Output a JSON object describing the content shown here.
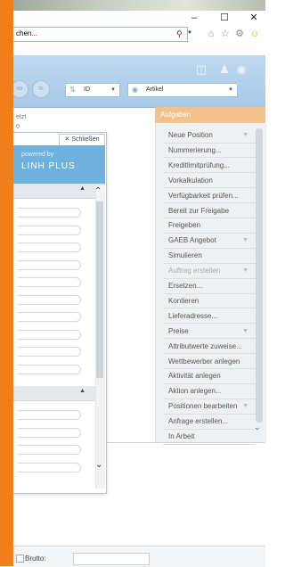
{
  "browser": {
    "address_text": "chen...",
    "window_controls": [
      "–",
      "☐",
      "✕"
    ],
    "toolbar_icons": [
      "home-icon",
      "star-icon",
      "gear-icon",
      "smiley-icon"
    ]
  },
  "toolbar": {
    "sort_select_value": "ID",
    "artikel_select_value": "Artikel"
  },
  "content": {
    "status_line1": "etzt",
    "status_line2": "0"
  },
  "aufgaben": {
    "header": "Aufgaben",
    "items": [
      {
        "label": "Neue Position",
        "has_arrow": true,
        "disabled": false
      },
      {
        "label": "Nummerierung...",
        "has_arrow": false,
        "disabled": false
      },
      {
        "label": "Kreditlimitprüfung...",
        "has_arrow": false,
        "disabled": false
      },
      {
        "label": "Vorkalkulation",
        "has_arrow": false,
        "disabled": false
      },
      {
        "label": "Verfügbarkeit prüfen...",
        "has_arrow": false,
        "disabled": false
      },
      {
        "label": "Bereit zur Freigabe",
        "has_arrow": false,
        "disabled": false
      },
      {
        "label": "Freigeben",
        "has_arrow": false,
        "disabled": false
      },
      {
        "label": "GAEB Angebot",
        "has_arrow": true,
        "disabled": false
      },
      {
        "label": "Simulieren",
        "has_arrow": false,
        "disabled": false
      },
      {
        "label": "Auftrag erstellen",
        "has_arrow": true,
        "disabled": true
      },
      {
        "label": "Ersetzen...",
        "has_arrow": false,
        "disabled": false
      },
      {
        "label": "Kontieren",
        "has_arrow": false,
        "disabled": false
      },
      {
        "label": "Lieferadresse...",
        "has_arrow": false,
        "disabled": false
      },
      {
        "label": "Preise",
        "has_arrow": true,
        "disabled": false
      },
      {
        "label": "Attributwerte zuweise...",
        "has_arrow": false,
        "disabled": false
      },
      {
        "label": "Wettbewerber anlegen",
        "has_arrow": false,
        "disabled": false
      },
      {
        "label": "Aktivität anlegen",
        "has_arrow": false,
        "disabled": false
      },
      {
        "label": "Aktion anlegen...",
        "has_arrow": false,
        "disabled": false
      },
      {
        "label": "Positionen bearbeiten",
        "has_arrow": true,
        "disabled": false
      },
      {
        "label": "Anfrage erstellen...",
        "has_arrow": false,
        "disabled": false
      },
      {
        "label": "In Arbeit",
        "has_arrow": false,
        "disabled": false
      }
    ]
  },
  "floating_panel": {
    "close_label": "Schließen",
    "powered_by": "powered by",
    "logo_text": "LINH PLUS"
  },
  "bottom": {
    "brutto_label": "Brutto:"
  },
  "colors": {
    "accent_orange": "#f07f1b",
    "aufgaben_header": "#f2c18e",
    "toolbar_blue": "#a8c9e6",
    "brand_blue": "#6fb1dd"
  }
}
